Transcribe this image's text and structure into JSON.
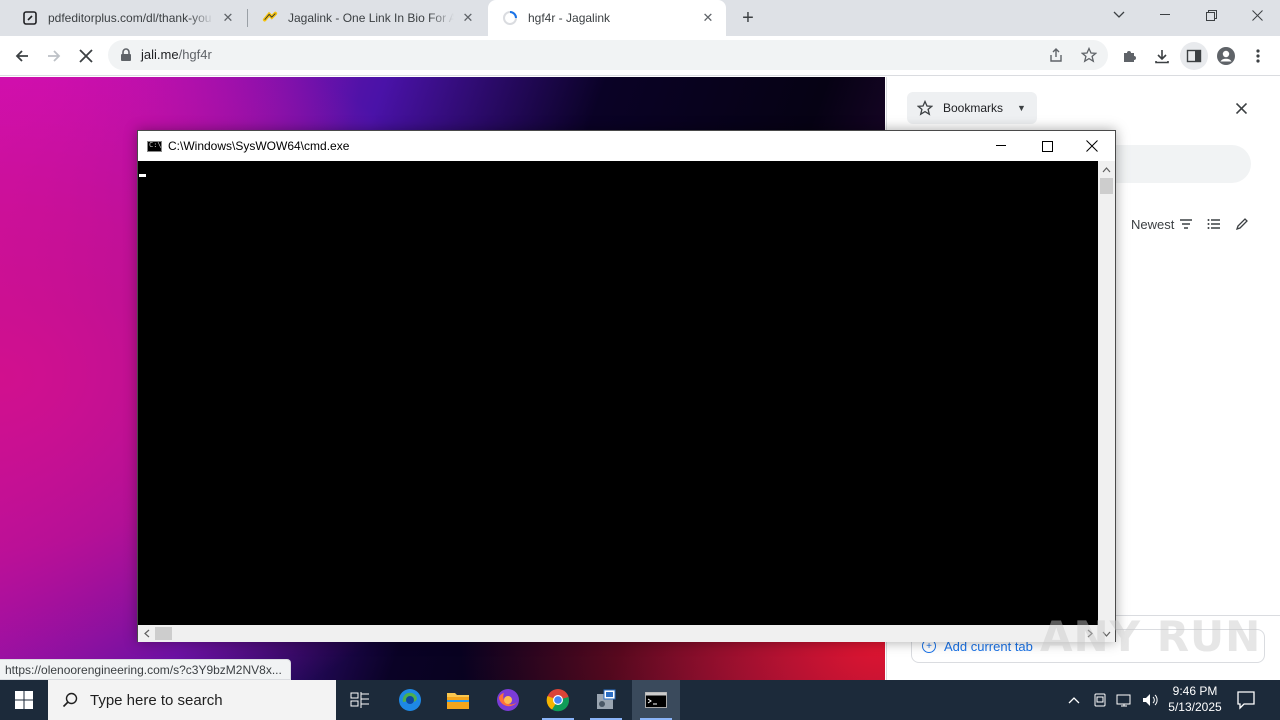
{
  "browser": {
    "tabs": [
      {
        "title": "pdfeditorplus.com/dl/thank-you",
        "favicon": "pdf-editor-icon"
      },
      {
        "title": "Jagalink - One Link In Bio For All",
        "favicon": "jagalink-icon"
      },
      {
        "title": "hgf4r - Jagalink",
        "favicon": "loading-icon",
        "active": true
      }
    ],
    "address": {
      "host": "jali.me",
      "path": "/hgf4r"
    },
    "status_url": "https://olenoorengineering.com/s?c3Y9bzM2NV8x..."
  },
  "side_panel": {
    "selector_label": "Bookmarks",
    "sort_label": "Newest",
    "add_tab_label": "Add current tab"
  },
  "cmd": {
    "title": "C:\\Windows\\SysWOW64\\cmd.exe"
  },
  "taskbar": {
    "search_placeholder": "Type here to search",
    "time": "9:46 PM",
    "date": "5/13/2025"
  },
  "watermark": "ANY RUN",
  "colors": {
    "taskbar_bg": "#1c2a3a",
    "tabstrip_bg": "#dee1e6",
    "accent": "#1a73e8"
  }
}
